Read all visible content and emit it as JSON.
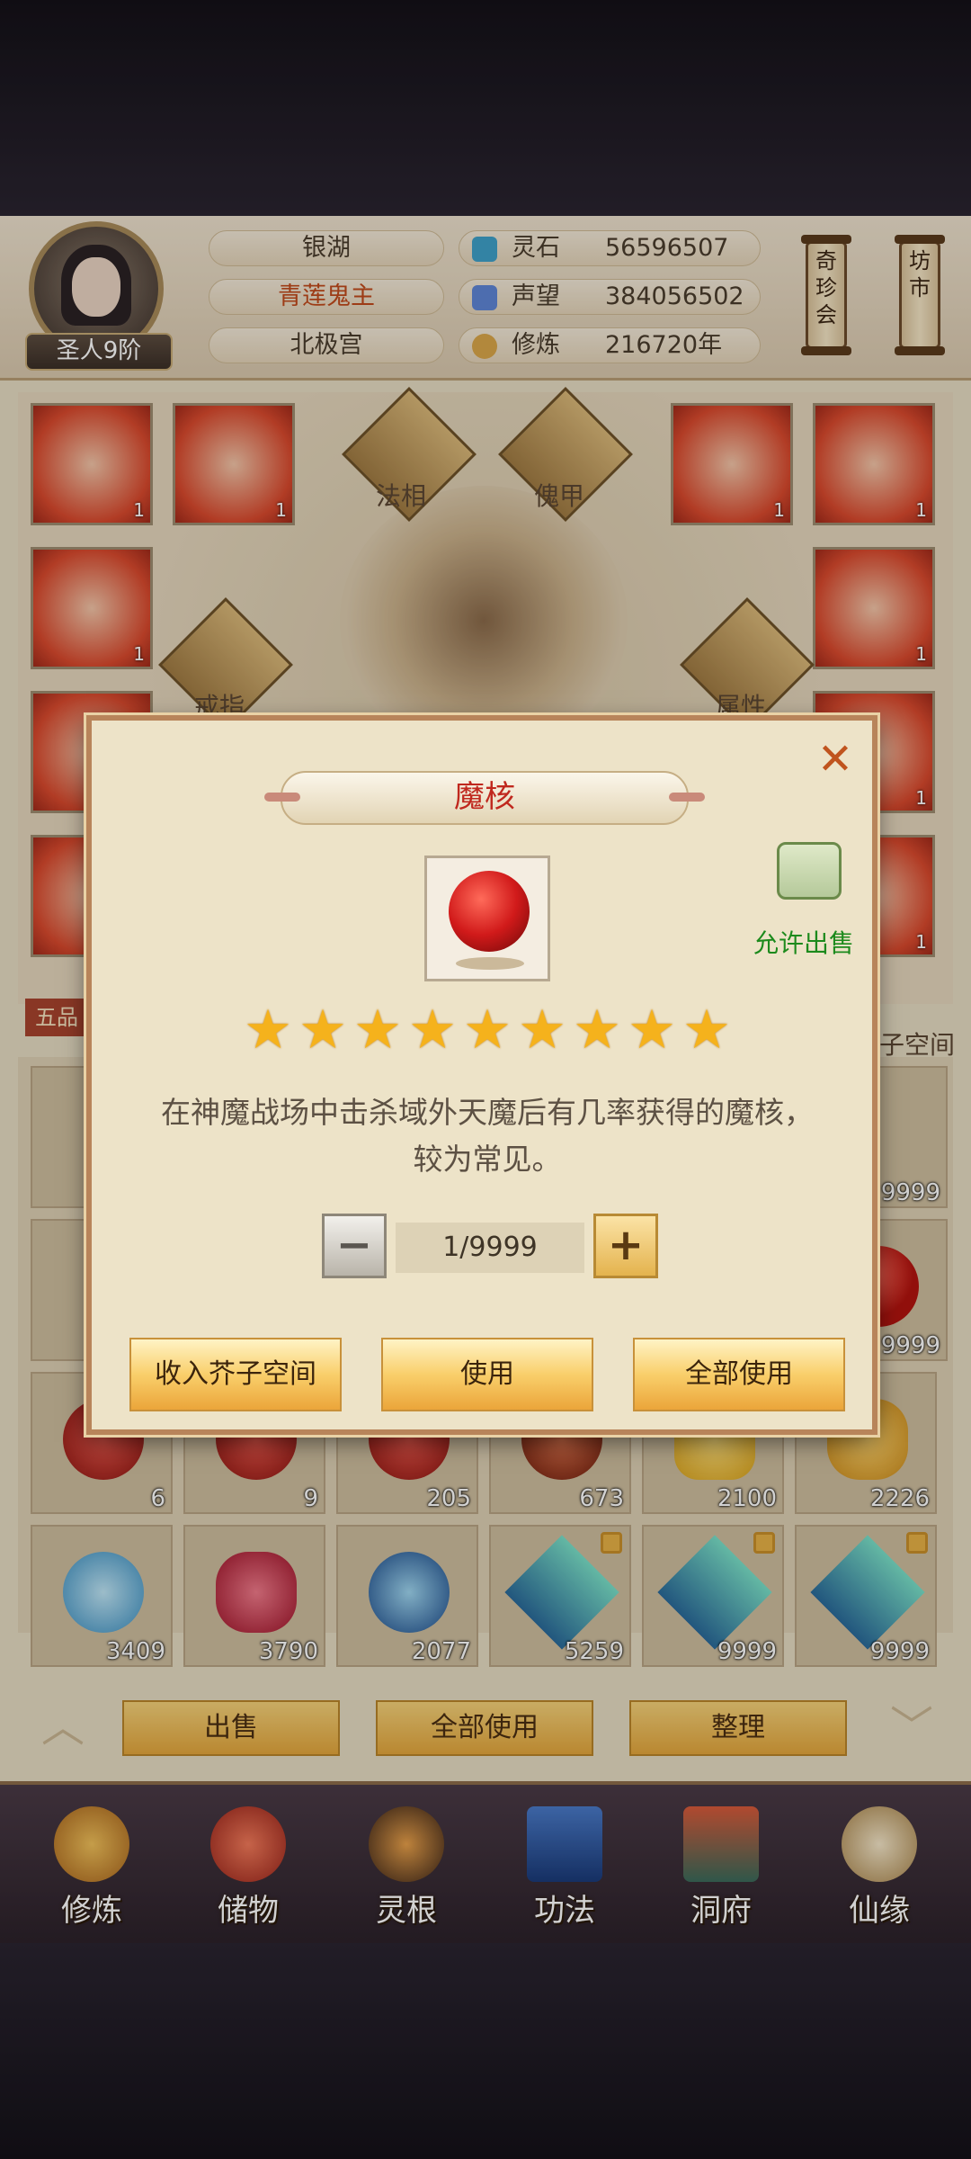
{
  "player": {
    "rank": "圣人9阶",
    "names": [
      "银湖",
      "青莲鬼主",
      "北极宫"
    ],
    "stats": [
      {
        "label": "灵石",
        "value": "56596507",
        "icon": "spirit-stone-icon"
      },
      {
        "label": "声望",
        "value": "384056502",
        "icon": "prestige-icon"
      },
      {
        "label": "修炼",
        "value": "216720年",
        "icon": "meditation-icon"
      }
    ]
  },
  "scrolls": [
    "奇珍会",
    "坊市"
  ],
  "equip": {
    "slot_labels": [
      "法相",
      "傀甲",
      "戒指",
      "属性"
    ],
    "counts": [
      "1",
      "1",
      "1",
      "1",
      "1",
      "1",
      "1",
      "1",
      "1",
      "1",
      "1",
      "1"
    ]
  },
  "inventory": {
    "tag": "五品",
    "space_label": "芥子空间",
    "row_counts": [
      "6",
      "9",
      "205",
      "673",
      "2100",
      "2226"
    ],
    "row2_counts": [
      "3409",
      "3790",
      "2077",
      "5259",
      "9999",
      "9999"
    ],
    "side_counts": [
      "9999",
      "9999"
    ]
  },
  "bottom_buttons": [
    "出售",
    "全部使用",
    "整理"
  ],
  "nav": [
    "修炼",
    "储物",
    "灵根",
    "功法",
    "洞府",
    "仙缘"
  ],
  "modal": {
    "title": "魔核",
    "close": "✕",
    "sell_status": "允许出售",
    "stars": 9,
    "description_line1": "在神魔战场中击杀域外天魔后有几率获得的魔核，",
    "description_line2": "较为常见。",
    "quantity": "1/9999",
    "minus": "−",
    "plus": "+",
    "buttons": [
      "收入芥子空间",
      "使用",
      "全部使用"
    ]
  },
  "colors": {
    "title_red": "#c0281e",
    "sell_green": "#1c8a1c",
    "gold": "#f5b21c"
  }
}
